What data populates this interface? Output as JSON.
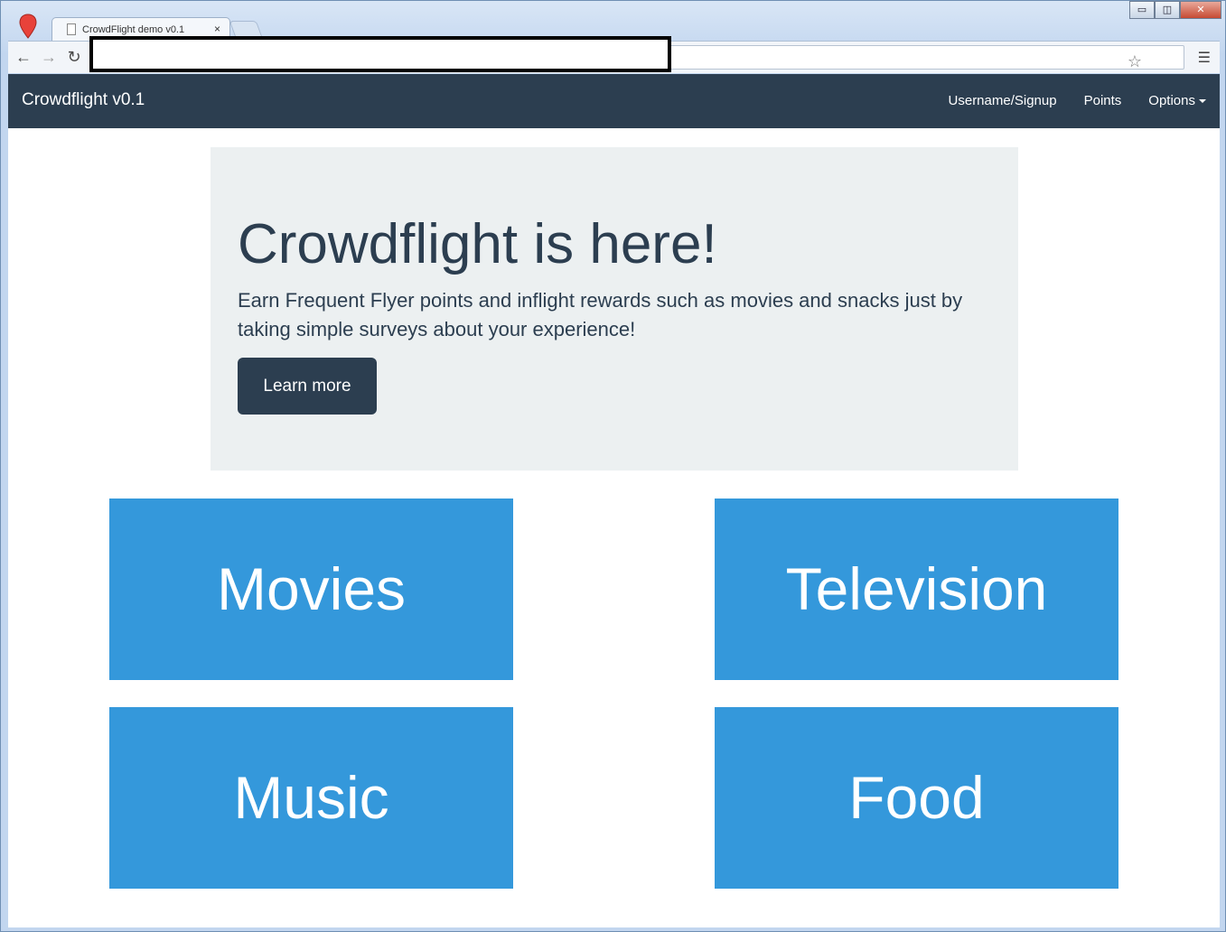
{
  "browser": {
    "tab_title": "CrowdFlight demo v0.1",
    "tab_close": "×",
    "back": "←",
    "forward": "→",
    "reload": "↻",
    "star": "☆",
    "menu": "☰",
    "win_min": "▭",
    "win_max": "◫",
    "win_close": "✕"
  },
  "navbar": {
    "brand": "Crowdflight v0.1",
    "links": {
      "username": "Username/Signup",
      "points": "Points",
      "options": "Options"
    }
  },
  "hero": {
    "title": "Crowdflight is here!",
    "text": "Earn Frequent Flyer points and inflight rewards such as movies and snacks just by taking simple surveys about your experience!",
    "button": "Learn more"
  },
  "categories": {
    "movies": "Movies",
    "television": "Television",
    "music": "Music",
    "food": "Food"
  },
  "colors": {
    "navbar": "#2c3e50",
    "tile": "#3498db",
    "jumbotron": "#ecf0f1"
  }
}
